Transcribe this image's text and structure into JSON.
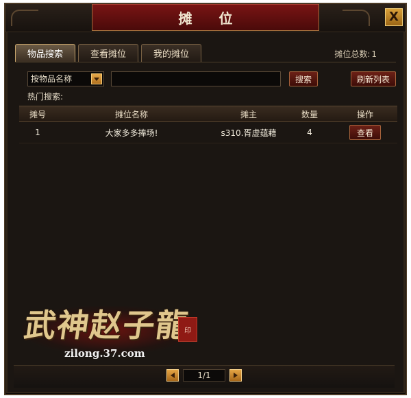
{
  "window": {
    "title": "摊 位",
    "close_label": "X"
  },
  "tabs": [
    {
      "label": "物品搜索",
      "active": true
    },
    {
      "label": "查看摊位",
      "active": false
    },
    {
      "label": "我的摊位",
      "active": false
    }
  ],
  "stall_total": {
    "label": "摊位总数:",
    "value": "1"
  },
  "search": {
    "type_selected": "按物品名称",
    "input_value": "",
    "search_label": "搜索",
    "refresh_label": "刷新列表",
    "hot_label": "热门搜索:"
  },
  "table": {
    "headers": [
      "摊号",
      "摊位名称",
      "摊主",
      "数量",
      "操作"
    ],
    "rows": [
      {
        "id": "1",
        "name": "大家多多捧场!",
        "owner": "s310.胥虚蕴藉",
        "qty": "4",
        "action": "查看"
      }
    ]
  },
  "logo": {
    "title": "武神赵子龍",
    "url": "zilong.37.com"
  },
  "pager": {
    "text": "1/1"
  },
  "colors": {
    "accent": "#c7a46b",
    "title_bar": "#7a1514",
    "button": "#6c2116"
  },
  "icons": {
    "close": "close-icon",
    "dropdown": "chevron-down-icon",
    "prev": "prev-page-icon",
    "next": "next-page-icon"
  }
}
